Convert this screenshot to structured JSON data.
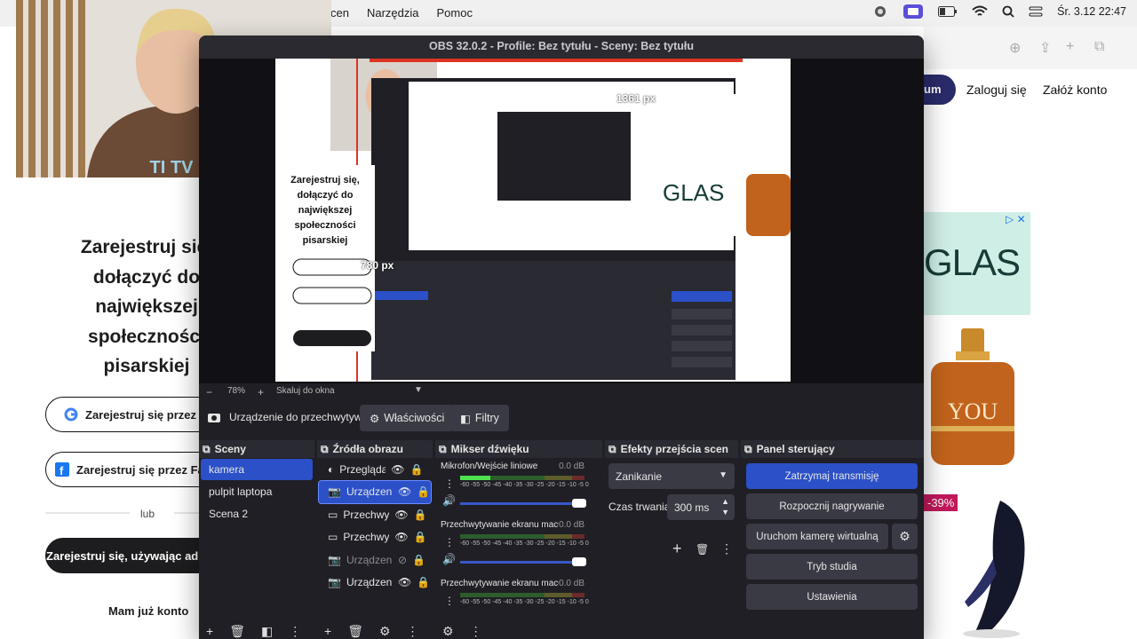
{
  "menubar": {
    "menus": [
      "cen",
      "Narzędzia",
      "Pomoc"
    ],
    "clock": "Śr. 3.12  22:47"
  },
  "site": {
    "premium_label": "um",
    "login_label": "Zaloguj się",
    "signup_label": "Załóż konto",
    "headline": "Zarejestruj się, dołączyć do największej społeczności pisarskiej",
    "google_btn": "Zarejestruj się przez G",
    "facebook_btn": "Zarejestruj się przez Fac",
    "or_label": "lub",
    "email_btn": "Zarejestruj się, używając adre",
    "have_account": "Mam już konto",
    "ad_text": "GLAS",
    "discount": "-39%"
  },
  "obs": {
    "title": "OBS 32.0.2 - Profile: Bez tytułu - Sceny: Bez tytułu",
    "preview_label_px1": "1361 px",
    "preview_label_px2": "780 px",
    "zoom": {
      "minus": "−",
      "value": "78%",
      "plus": "+",
      "mode": "Skaluj do okna"
    },
    "source_toolbar": {
      "device_name": "Urządzenie do przechwytywa",
      "properties": "Właściwości",
      "filters": "Filtry"
    },
    "scenes": {
      "title": "Sceny",
      "items": [
        "kamera",
        "pulpit laptopa",
        "Scena 2"
      ]
    },
    "sources": {
      "title": "Źródła obrazu",
      "items": [
        "Przeglądar",
        "Urządzeni",
        "Przechwyt",
        "Przechwyt",
        "Urządzeni",
        "Urządzeni"
      ]
    },
    "mixer": {
      "title": "Mikser dźwięku",
      "ticks": "-60 -55 -50 -45 -40 -35 -30 -25 -20 -15 -10 -5  0",
      "channels": [
        {
          "name": "Mikrofon/Wejście liniowe",
          "db": "0.0 dB",
          "level": 0.24
        },
        {
          "name": "Przechwytywanie ekranu macOS",
          "db": "0.0 dB",
          "level": 0
        },
        {
          "name": "Przechwytywanie ekranu macOS",
          "db": "0.0 dB",
          "level": 0
        }
      ]
    },
    "transitions": {
      "title": "Efekty przejścia scen",
      "selected": "Zanikanie",
      "duration_label": "Czas trwania",
      "duration_value": "300 ms"
    },
    "controls": {
      "title": "Panel sterujący",
      "stop_stream": "Zatrzymaj transmisję",
      "start_record": "Rozpocznij nagrywanie",
      "virtual_cam": "Uruchom kamerę wirtualną",
      "studio_mode": "Tryb studia",
      "settings": "Ustawienia"
    }
  }
}
